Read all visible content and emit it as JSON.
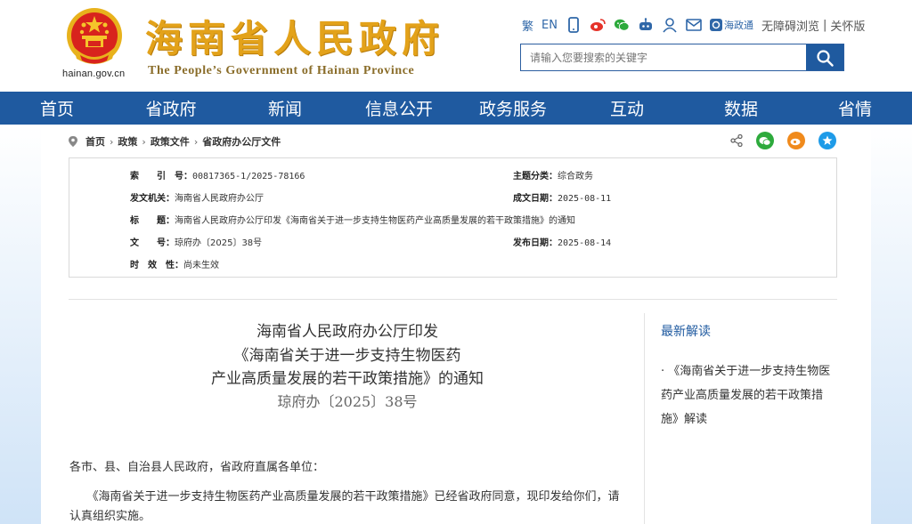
{
  "header": {
    "domain": "hainan.gov.cn",
    "title_cn": "海南省人民政府",
    "title_en": "The People’s Government  of Hainan Province"
  },
  "toolbar": {
    "traditional": "繁",
    "english": "EN",
    "haizhengtong": "海政通",
    "accessible": "无障碍浏览",
    "separator": "|",
    "care": "关怀版"
  },
  "search": {
    "placeholder": "请输入您要搜索的关键字"
  },
  "nav": {
    "items": [
      "首页",
      "省政府",
      "新闻",
      "信息公开",
      "政务服务",
      "互动",
      "数据",
      "省情"
    ]
  },
  "breadcrumb": {
    "items": [
      "首页",
      "政策",
      "政策文件",
      "省政府办公厅文件"
    ],
    "separator": "›"
  },
  "info": {
    "index_key": "索　　引　号：",
    "index_val": "00817365-1/2025-78166",
    "category_key": "主题分类：",
    "category_val": "综合政务",
    "issuer_key": "发文机关：",
    "issuer_val": "海南省人民政府办公厅",
    "written_key": "成文日期：",
    "written_val": "2025-08-11",
    "title_key": "标　　题：",
    "title_val": "海南省人民政府办公厅印发《海南省关于进一步支持生物医药产业高质量发展的若干政策措施》的通知",
    "docno_key": "文　　号：",
    "docno_val": "琼府办〔2025〕38号",
    "publish_key": "发布日期：",
    "publish_val": "2025-08-14",
    "validity_key": "时　效　性：",
    "validity_val": "尚未生效"
  },
  "article": {
    "title_line1": "海南省人民政府办公厅印发",
    "title_line2": "《海南省关于进一步支持生物医药",
    "title_line3": "产业高质量发展的若干政策措施》的通知",
    "doc_number": "琼府办〔2025〕38号",
    "salutation": "各市、县、自治县人民政府，省政府直属各单位：",
    "body": "　　《海南省关于进一步支持生物医药产业高质量发展的若干政策措施》已经省政府同意，现印发给你们，请认真组织实施。"
  },
  "sidebar": {
    "title": "最新解读",
    "link": "· 《海南省关于进一步支持生物医药产业高质量发展的若干政策措施》解读"
  },
  "colors": {
    "nav_blue": "#1f5aa0",
    "title_gold": "#e3a21a",
    "link_blue": "#2f67a8"
  }
}
